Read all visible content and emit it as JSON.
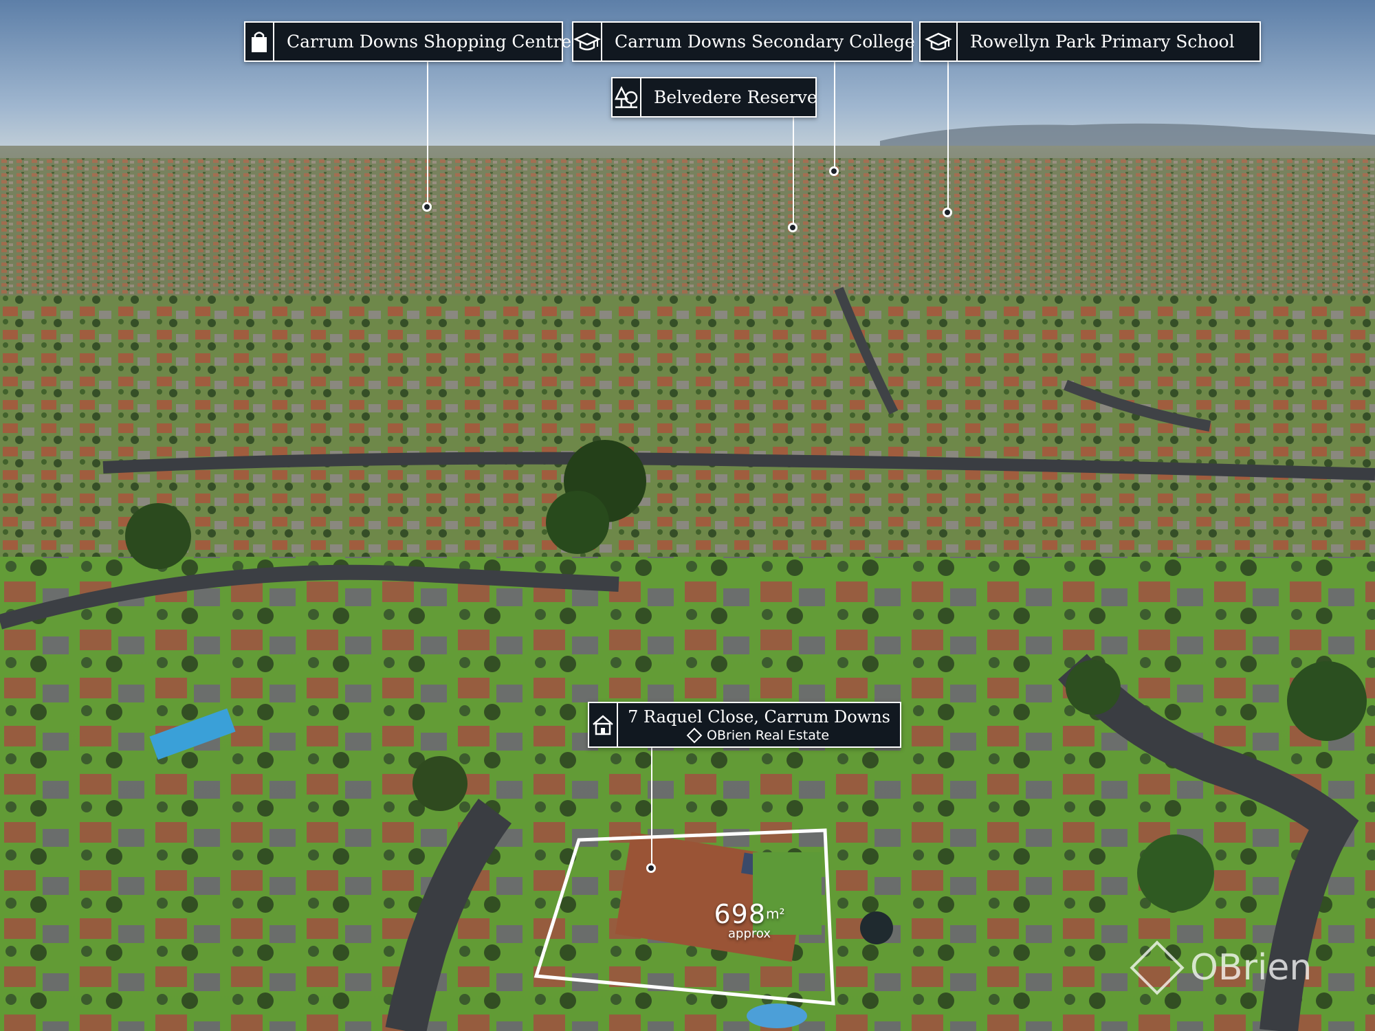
{
  "photo": {
    "description_colors": {
      "sky_top": "#5d7fa8",
      "sky_horizon": "#aec3d9",
      "suburb": "#6e7d55",
      "roof_terracotta": "#a65a3c",
      "road": "#3a3d42",
      "lawn": "#5aa82e"
    }
  },
  "callouts": {
    "shopping": {
      "label": "Carrum Downs Shopping Centre",
      "icon": "shopping-bag-icon"
    },
    "secondary": {
      "label": "Carrum Downs Secondary College",
      "icon": "graduation-cap-icon"
    },
    "primary": {
      "label": "Rowellyn Park Primary School",
      "icon": "graduation-cap-icon"
    },
    "reserve": {
      "label": "Belvedere Reserve",
      "icon": "trees-icon"
    }
  },
  "property": {
    "address": "7 Raquel Close, Carrum Downs",
    "agent": "OBrien Real Estate",
    "icon": "house-icon",
    "land_area_number": "698",
    "land_area_unit": "m²",
    "land_area_note": "approx"
  },
  "watermark": {
    "text": "OBrien"
  }
}
